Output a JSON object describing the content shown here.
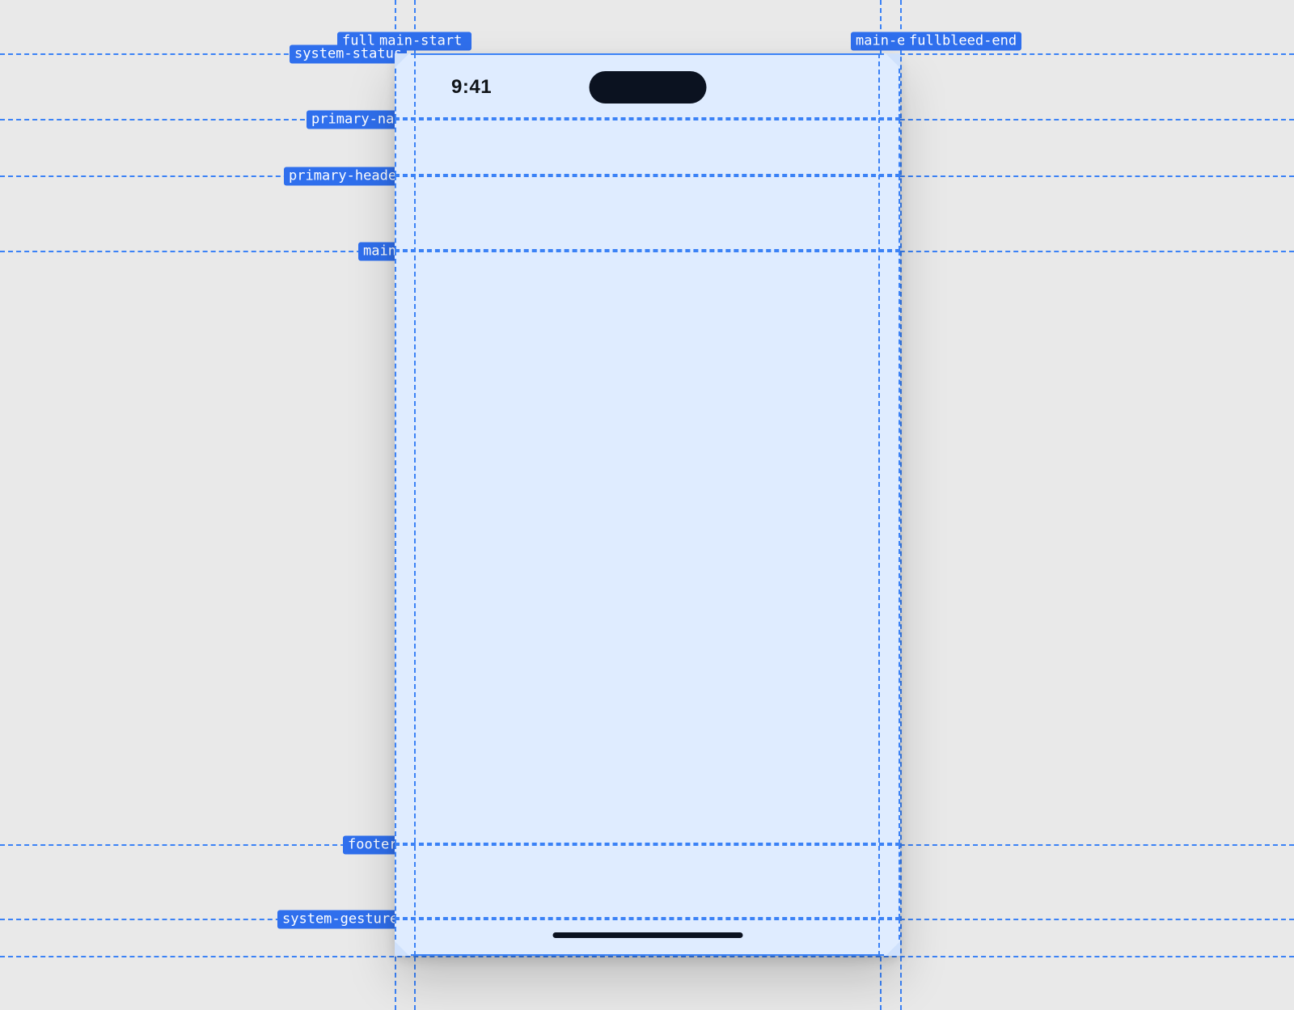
{
  "status_bar": {
    "time": "9:41"
  },
  "guides": {
    "vertical": {
      "fullbleed_start": "fullbleed-start",
      "main_start": "main-start",
      "main_end": "main-end",
      "fullbleed_end": "fullbleed-end"
    },
    "horizontal": {
      "system_status": "system-status",
      "primary_nav": "primary-nav",
      "primary_header": "primary-header",
      "main": "main",
      "footer": "footer",
      "system_gestures": "system-gestures"
    }
  }
}
